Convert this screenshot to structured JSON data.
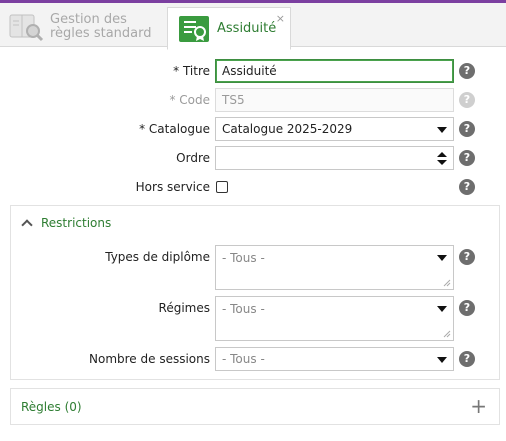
{
  "tabs": [
    {
      "label_line1": "Gestion des",
      "label_line2": "règles standard",
      "icon": "book-search-icon"
    },
    {
      "label": "Assiduité",
      "icon": "list-badge-icon",
      "close": "×"
    }
  ],
  "form": {
    "titre": {
      "label": "* Titre",
      "value": "Assiduité"
    },
    "code": {
      "label": "* Code",
      "value": "TS5"
    },
    "catalogue": {
      "label": "* Catalogue",
      "value": "Catalogue 2025-2029"
    },
    "ordre": {
      "label": "Ordre",
      "value": ""
    },
    "hors_service": {
      "label": "Hors service",
      "checked": false
    }
  },
  "restrictions": {
    "title": "Restrictions",
    "types_diplome": {
      "label": "Types de diplôme",
      "value": "- Tous -"
    },
    "regimes": {
      "label": "Régimes",
      "value": "- Tous -"
    },
    "nombre_sessions": {
      "label": "Nombre de sessions",
      "value": "- Tous -"
    }
  },
  "regles": {
    "title": "Règles (0)",
    "add": "+"
  },
  "help_glyph": "?",
  "colors": {
    "accent_green": "#2e7d32",
    "top_line": "#7b3fa0",
    "help_gray": "#6e6e6e"
  }
}
